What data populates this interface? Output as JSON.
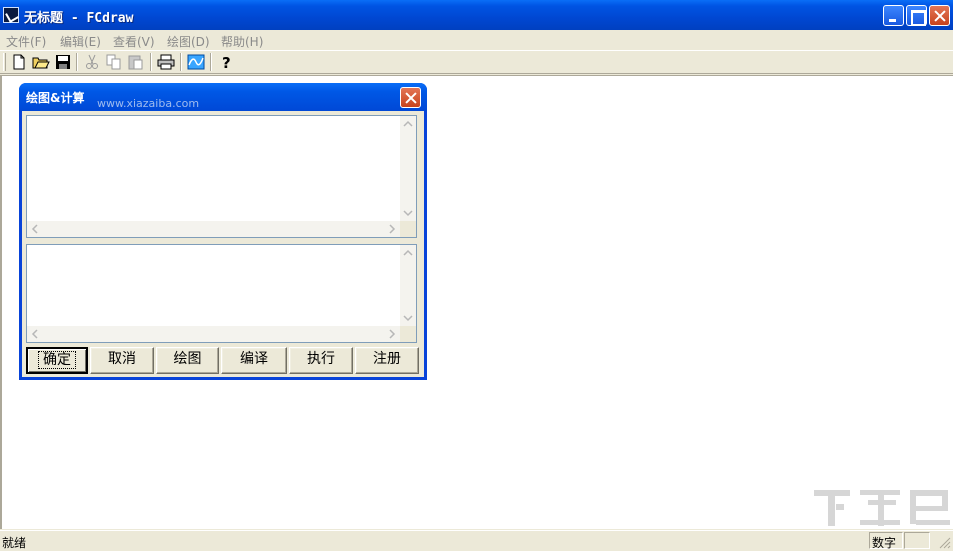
{
  "window": {
    "title": "无标题 - FCdraw"
  },
  "menu": {
    "items": [
      {
        "label": "文件(F)"
      },
      {
        "label": "编辑(E)"
      },
      {
        "label": "查看(V)"
      },
      {
        "label": "绘图(D)"
      },
      {
        "label": "帮助(H)"
      }
    ]
  },
  "toolbar": {
    "icons": [
      "new-icon",
      "open-icon",
      "save-icon",
      "cut-icon",
      "copy-icon",
      "paste-icon",
      "print-icon",
      "draw-icon",
      "help-icon"
    ]
  },
  "dialog": {
    "title": "绘图&计算",
    "watermark_site": "www.xiazaiba.com",
    "buttons": [
      {
        "label": "确定"
      },
      {
        "label": "取消"
      },
      {
        "label": "绘图"
      },
      {
        "label": "编译"
      },
      {
        "label": "执行"
      },
      {
        "label": "注册"
      }
    ]
  },
  "statusbar": {
    "text": "就绪",
    "num_indicator": "数字"
  },
  "colors": {
    "titlebar": "#0054e3",
    "close_button": "#c8431c",
    "face": "#ece9d8"
  }
}
